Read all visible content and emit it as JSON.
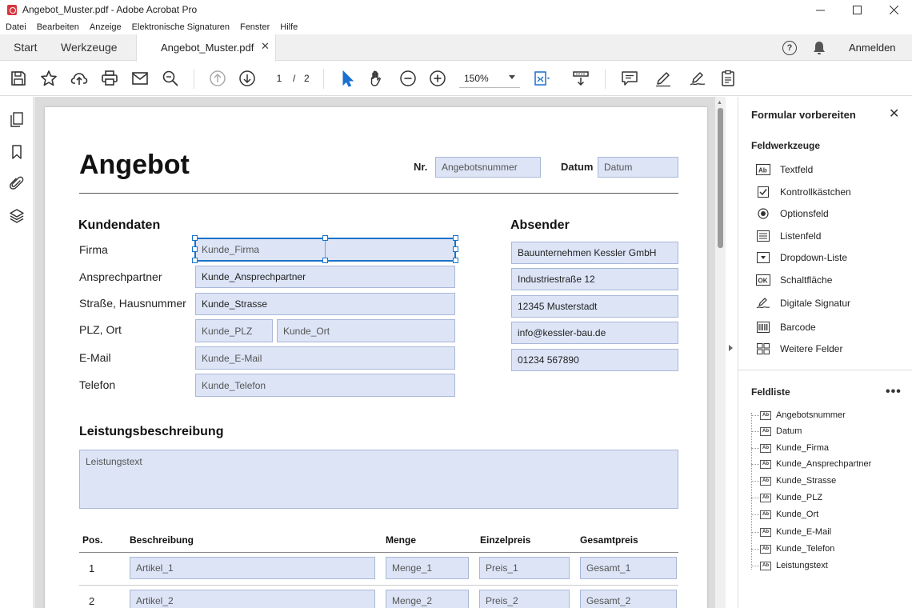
{
  "window": {
    "title": "Angebot_Muster.pdf - Adobe Acrobat Pro",
    "minimize": "—",
    "maximize": "☐",
    "close": "✕"
  },
  "menu": [
    "Datei",
    "Bearbeiten",
    "Anzeige",
    "Elektronische Signaturen",
    "Fenster",
    "Hilfe"
  ],
  "tabs": {
    "start": "Start",
    "tools": "Werkzeuge",
    "document": "Angebot_Muster.pdf",
    "close": "✕",
    "help": "?",
    "signin": "Anmelden"
  },
  "toolbar": {
    "page_current": "1",
    "page_sep": "/",
    "page_total": "2",
    "zoom": "150%"
  },
  "document": {
    "title": "Angebot",
    "nr_label": "Nr.",
    "nr_field": "Angebotsnummer",
    "date_label": "Datum",
    "date_field": "Datum",
    "customer_heading": "Kundendaten",
    "sender_heading": "Absender",
    "customer_rows": [
      {
        "label": "Firma",
        "field": "Kunde_Firma"
      },
      {
        "label": "Ansprechpartner",
        "field": "Kunde_Ansprechpartner"
      },
      {
        "label": "Straße, Hausnummer",
        "field": "Kunde_Strasse"
      },
      {
        "label": "PLZ, Ort",
        "field": "Kunde_PLZ",
        "field2": "Kunde_Ort"
      },
      {
        "label": "E-Mail",
        "field": "Kunde_E-Mail"
      },
      {
        "label": "Telefon",
        "field": "Kunde_Telefon"
      }
    ],
    "sender_fields": [
      "Bauunternehmen Kessler GmbH",
      "Industriestraße 12",
      "12345 Musterstadt",
      "info@kessler-bau.de",
      "01234 567890"
    ],
    "service_heading": "Leistungsbeschreibung",
    "service_field": "Leistungstext",
    "table_headers": [
      "Pos.",
      "Beschreibung",
      "Menge",
      "Einzelpreis",
      "Gesamtpreis"
    ],
    "table_rows": [
      {
        "pos": "1",
        "desc": "Artikel_1",
        "qty": "Menge_1",
        "price": "Preis_1",
        "total": "Gesamt_1"
      },
      {
        "pos": "2",
        "desc": "Artikel_2",
        "qty": "Menge_2",
        "price": "Preis_2",
        "total": "Gesamt_2"
      }
    ]
  },
  "right_panel": {
    "title": "Formular vorbereiten",
    "close": "✕",
    "tools_heading": "Feldwerkzeuge",
    "tools": [
      {
        "label": "Textfeld",
        "icon": "textfield-icon"
      },
      {
        "label": "Kontrollkästchen",
        "icon": "checkbox-icon"
      },
      {
        "label": "Optionsfeld",
        "icon": "radio-icon"
      },
      {
        "label": "Listenfeld",
        "icon": "listbox-icon"
      },
      {
        "label": "Dropdown-Liste",
        "icon": "dropdown-icon"
      },
      {
        "label": "Schaltfläche",
        "icon": "button-icon"
      },
      {
        "label": "Digitale Signatur",
        "icon": "signature-icon"
      },
      {
        "label": "Barcode",
        "icon": "barcode-icon"
      },
      {
        "label": "Weitere Felder",
        "icon": "more-fields-icon"
      }
    ],
    "field_list_heading": "Feldliste",
    "more": "•••",
    "field_list": [
      "Angebotsnummer",
      "Datum",
      "Kunde_Firma",
      "Kunde_Ansprechpartner",
      "Kunde_Strasse",
      "Kunde_PLZ",
      "Kunde_Ort",
      "Kunde_E-Mail",
      "Kunde_Telefon",
      "Leistungstext"
    ],
    "field_icon_text": "Ab"
  },
  "colors": {
    "field_fill": "#dce4f6",
    "selection": "#1a73c9",
    "accent_red": "#d7373f"
  }
}
